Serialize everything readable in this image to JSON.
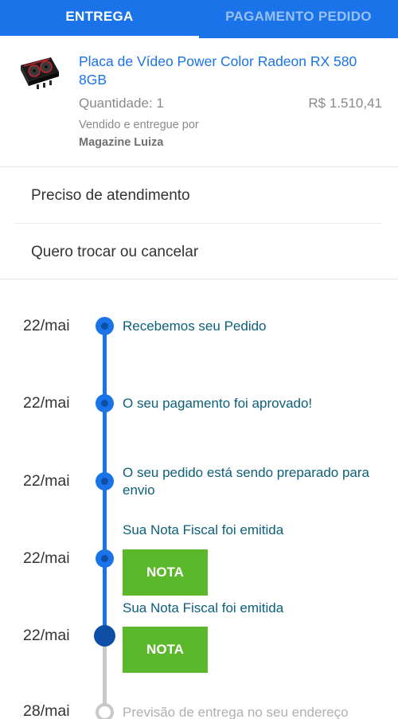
{
  "tabs": [
    {
      "label": "ENTREGA",
      "active": true
    },
    {
      "label": "PAGAMENTO PEDIDO",
      "active": false
    }
  ],
  "product": {
    "title": "Placa de Vídeo Power Color Radeon RX 580 8GB",
    "quantity": "Quantidade: 1",
    "price": "R$ 1.510,41",
    "sold_by": "Vendido e entregue por",
    "seller": "Magazine Luiza",
    "thumbnail_icon": "graphics-card-icon"
  },
  "menu": [
    {
      "label": "Preciso de atendimento"
    },
    {
      "label": "Quero trocar ou cancelar"
    }
  ],
  "timeline": {
    "events": [
      {
        "date": "22/mai",
        "text": "Recebemos seu Pedido",
        "status": "done"
      },
      {
        "date": "22/mai",
        "text": "O seu pagamento foi aprovado!",
        "status": "done"
      },
      {
        "date": "22/mai",
        "text": "O seu pedido está sendo preparado para envio",
        "status": "done"
      },
      {
        "date": "22/mai",
        "text": "Sua Nota Fiscal foi emitida",
        "button": "NOTA",
        "status": "done"
      },
      {
        "date": "22/mai",
        "text": "Sua Nota Fiscal foi emitida",
        "button": "NOTA",
        "status": "current"
      },
      {
        "date": "28/mai",
        "text": "Previsão de entrega no seu endereço",
        "status": "pending"
      }
    ]
  },
  "colors": {
    "primary": "#1a73e8",
    "event_text": "#0b5f7a",
    "nota_button": "#5cb82b",
    "pending": "#c8c8c8"
  }
}
